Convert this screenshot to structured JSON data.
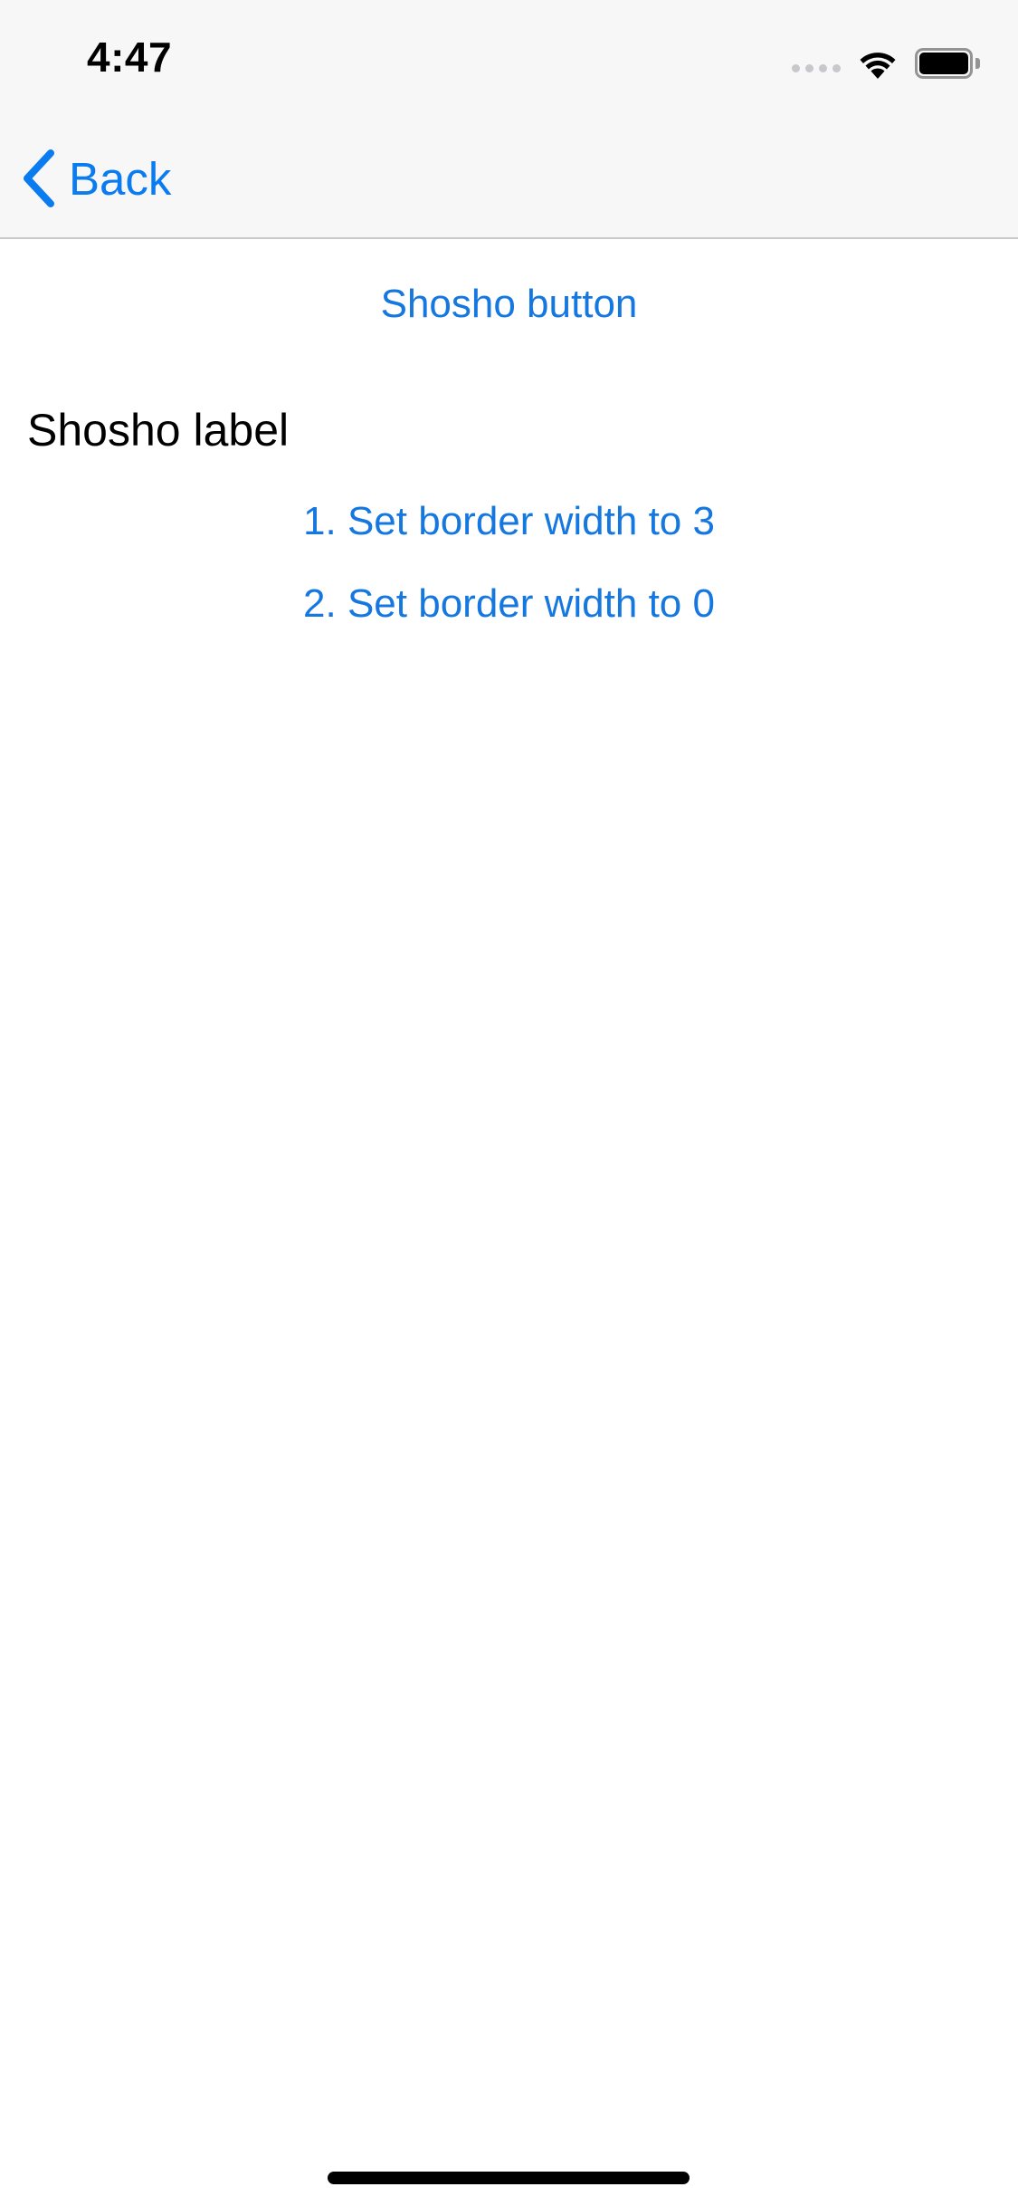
{
  "status_bar": {
    "time": "4:47",
    "icons": [
      "signal-dots-icon",
      "wifi-icon",
      "battery-icon"
    ]
  },
  "nav_bar": {
    "back_label": "Back",
    "back_icon": "chevron-left-icon"
  },
  "content": {
    "shosho_button_label": "Shosho button",
    "shosho_label_text": "Shosho label",
    "step_1_label": "1. Set border width to 3",
    "step_2_label": "2. Set border width to 0"
  },
  "colors": {
    "accent": "#1577e0",
    "nav_background": "#f7f7f7",
    "text": "#000000",
    "background": "#ffffff"
  }
}
